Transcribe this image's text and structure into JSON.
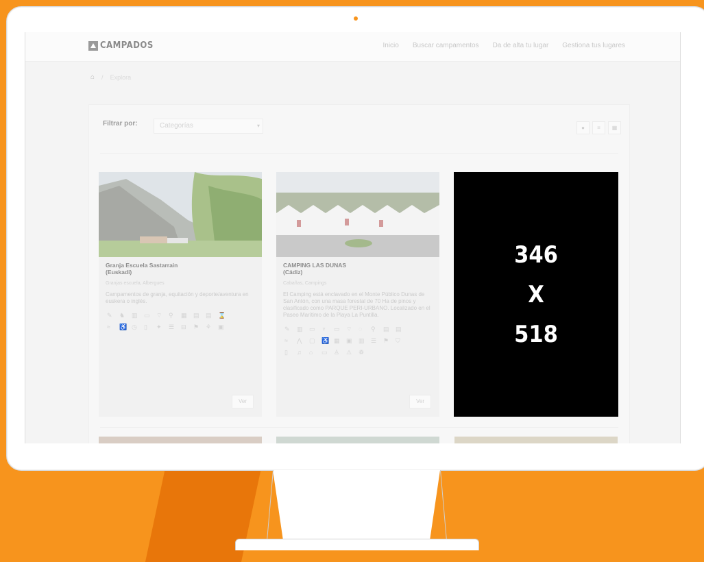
{
  "brand": {
    "name": "CAMPADOS"
  },
  "nav": [
    "Inicio",
    "Buscar campamentos",
    "Da de alta tu lugar",
    "Gestiona tus lugares"
  ],
  "breadcrumb": {
    "sep": "/",
    "current": "Explora"
  },
  "filter": {
    "label": "Filtrar por:",
    "select_value": "Categorías"
  },
  "cards": [
    {
      "title": "Granja Escuela Sastarrain",
      "region": "(Euskadi)",
      "categories": "Granjas escuela, Albergues",
      "description": "Campamentos de granja, equitación y deporte/aventura en euskera o inglés.",
      "button": "Ver"
    },
    {
      "title": "CAMPING LAS DUNAS",
      "region": "(Cádiz)",
      "categories": "Cabañas, Campings",
      "description": "El Camping está enclavado en el Monte Público Dunas de San Antón, con una masa forestal de 70 Ha de pinos y clasificado como PARQUE PERI-URBANO. Localizado en el Paseo Marítimo de la Playa La Puntilla.",
      "button": "Ver"
    }
  ],
  "placeholder": {
    "line1": "346",
    "line2": "X",
    "line3": "518"
  },
  "colors": {
    "accent": "#f7941d",
    "accent_dark": "#e8760a"
  }
}
